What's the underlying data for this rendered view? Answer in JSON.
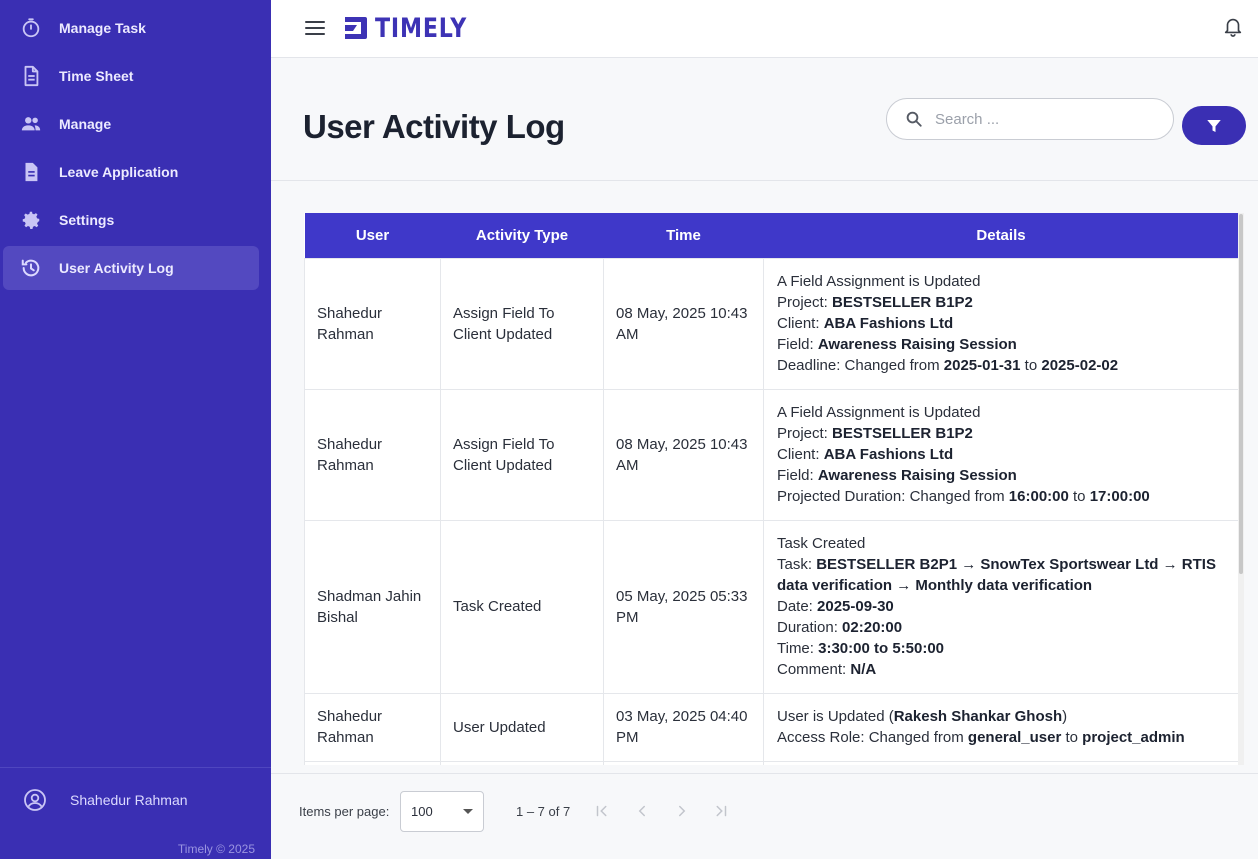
{
  "sidebar": {
    "items": [
      {
        "label": "Manage Task",
        "icon": "timer-icon"
      },
      {
        "label": "Time Sheet",
        "icon": "document-icon"
      },
      {
        "label": "Manage",
        "icon": "people-icon"
      },
      {
        "label": "Leave Application",
        "icon": "file-icon"
      },
      {
        "label": "Settings",
        "icon": "gear-icon"
      },
      {
        "label": "User Activity Log",
        "icon": "history-icon",
        "active": true
      }
    ],
    "profile_name": "Shahedur Rahman",
    "copyright": "Timely © 2025"
  },
  "topbar": {
    "logo_text": "TIMELY"
  },
  "header": {
    "title": "User Activity Log",
    "search_placeholder": "Search ..."
  },
  "table": {
    "columns": [
      "User",
      "Activity Type",
      "Time",
      "Details"
    ],
    "rows": [
      {
        "user": "Shahedur Rahman",
        "activity": "Assign Field To Client Updated",
        "time": "08 May, 2025 10:43 AM",
        "details": [
          {
            "text": "A Field Assignment is Updated"
          },
          {
            "label": "Project: ",
            "value": "BESTSELLER B1P2"
          },
          {
            "label": "Client: ",
            "value": "ABA Fashions Ltd"
          },
          {
            "label": "Field: ",
            "value": "Awareness Raising Session"
          },
          {
            "label": "Deadline: Changed from ",
            "value": "2025-01-31",
            "mid": " to ",
            "value2": "2025-02-02"
          }
        ]
      },
      {
        "user": "Shahedur Rahman",
        "activity": "Assign Field To Client Updated",
        "time": "08 May, 2025 10:43 AM",
        "details": [
          {
            "text": "A Field Assignment is Updated"
          },
          {
            "label": "Project: ",
            "value": "BESTSELLER B1P2"
          },
          {
            "label": "Client: ",
            "value": "ABA Fashions Ltd"
          },
          {
            "label": "Field: ",
            "value": "Awareness Raising Session"
          },
          {
            "label": "Projected Duration: Changed from ",
            "value": "16:00:00",
            "mid": " to ",
            "value2": "17:00:00"
          }
        ]
      },
      {
        "user": "Shadman Jahin Bishal",
        "activity": "Task Created",
        "time": "05 May, 2025 05:33 PM",
        "details": [
          {
            "text": "Task Created"
          },
          {
            "label": "Task: ",
            "value": "BESTSELLER B2P1 → SnowTex Sportswear Ltd → RTIS data verification → Monthly data verification"
          },
          {
            "label": "Date: ",
            "value": "2025-09-30"
          },
          {
            "label": "Duration: ",
            "value": "02:20:00"
          },
          {
            "label": "Time: ",
            "value": "3:30:00 to 5:50:00"
          },
          {
            "label": "Comment: ",
            "value": "N/A"
          }
        ]
      },
      {
        "user": "Shahedur Rahman",
        "activity": "User Updated",
        "time": "03 May, 2025 04:40 PM",
        "details": [
          {
            "label": "User is Updated (",
            "value": "Rakesh Shankar Ghosh",
            "mid": ")"
          },
          {
            "label": "Access Role: Changed from ",
            "value": "general_user",
            "mid": " to ",
            "value2": "project_admin"
          }
        ]
      }
    ]
  },
  "paginator": {
    "items_per_page_label": "Items per page:",
    "items_per_page_value": "100",
    "range_label": "1 – 7 of 7"
  },
  "colors": {
    "sidebar_bg": "#3a2fb3",
    "accent": "#3f38c9",
    "active_item": "#5349c0"
  }
}
